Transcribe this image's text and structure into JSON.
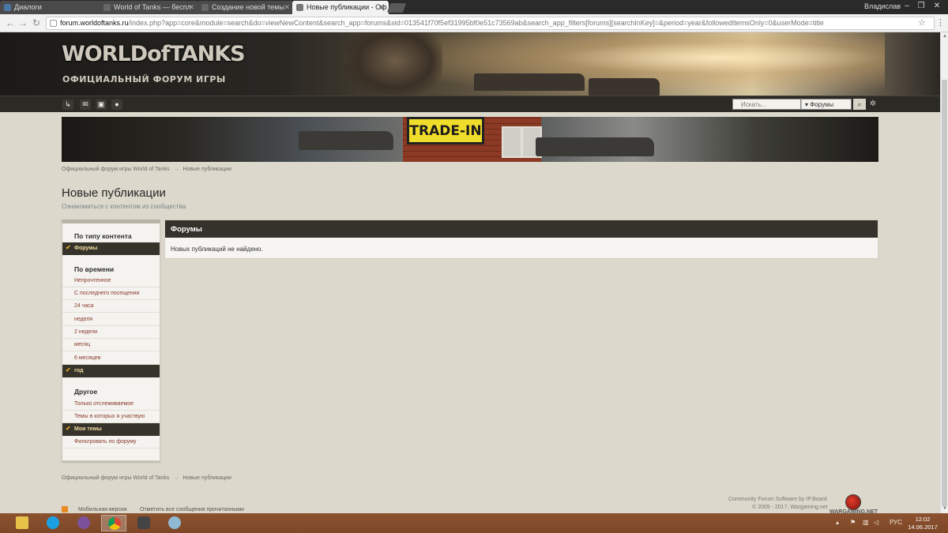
{
  "browser": {
    "tabs": [
      {
        "title": "Диалоги",
        "active": false
      },
      {
        "title": "World of Tanks — беспл",
        "active": false
      },
      {
        "title": "Создание новой темы",
        "active": false
      },
      {
        "title": "Новые публикации - Оф",
        "active": true
      }
    ],
    "user": "Владислав",
    "url_host": "forum.worldoftanks.ru",
    "url_path": "/index.php?app=core&module=search&do=viewNewContent&search_app=forums&sid=013541f70f5ef31995bf0e51c73569ab&search_app_filters[forums][searchInKey]=&period=year&followedItemsOnly=0&userMode=title"
  },
  "header": {
    "logo_main": "WORLDofTANKS",
    "logo_sub": "ОФИЦИАЛЬНЫЙ ФОРУМ ИГРЫ"
  },
  "search": {
    "placeholder": "Искать...",
    "filter": "Форумы"
  },
  "banner": {
    "label": "TRADE-IN"
  },
  "breadcrumb": {
    "home": "Официальный форум игры World of Tanks",
    "separator": "→",
    "current": "Новые публикации"
  },
  "page": {
    "title": "Новые публикации",
    "subtitle": "Ознакомиться с контентом из сообщества"
  },
  "sidebar": {
    "section_type": "По типу контента",
    "type_items": [
      {
        "label": "Форумы",
        "active": true
      }
    ],
    "section_time": "По времени",
    "time_items": [
      {
        "label": "Непрочтенное",
        "active": false
      },
      {
        "label": "С последнего посещения",
        "active": false
      },
      {
        "label": "24 часа",
        "active": false
      },
      {
        "label": "неделя",
        "active": false
      },
      {
        "label": "2 недели",
        "active": false
      },
      {
        "label": "месяц",
        "active": false
      },
      {
        "label": "6 месяцев",
        "active": false
      },
      {
        "label": "год",
        "active": true
      }
    ],
    "section_other": "Другое",
    "other_items": [
      {
        "label": "Только отслеживаемое",
        "active": false
      },
      {
        "label": "Темы в которых я участвую",
        "active": false
      },
      {
        "label": "Мои темы",
        "active": true
      },
      {
        "label": "Фильтровать по форуму",
        "active": false
      }
    ]
  },
  "main": {
    "header": "Форумы",
    "empty_message": "Новых публикаций не найдено."
  },
  "footer": {
    "mobile": "Мобильная версия",
    "mark_read": "Отметить все сообщения прочитанными",
    "software": "Community Forum Software by IP.Board",
    "copyright": "© 2009 - 2017, Wargaming.net",
    "wg": "WARGAMING.NET"
  },
  "taskbar": {
    "lang": "РУС",
    "time": "12:02",
    "date": "14.06.2017"
  },
  "colors": {
    "page_bg": "#dcd9cc",
    "dark_bar": "#34322b",
    "link": "#8b3a2d",
    "active_text": "#f3dca0",
    "check": "#e0a520",
    "taskbar": "#8b5230"
  }
}
